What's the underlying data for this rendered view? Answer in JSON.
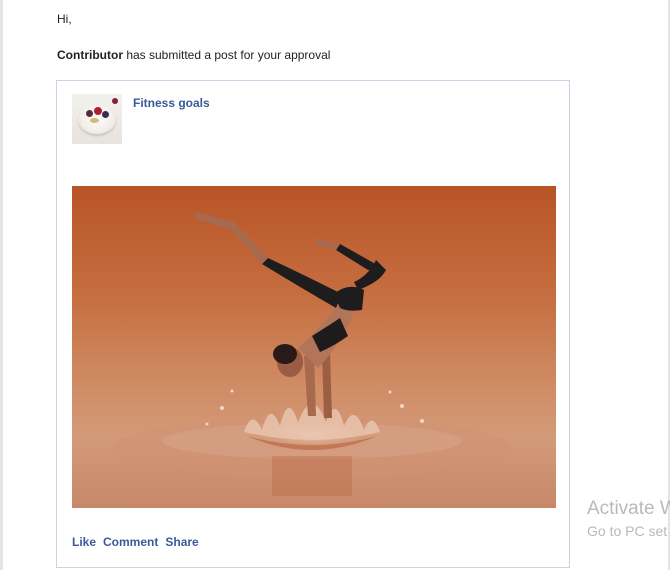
{
  "email": {
    "greeting": "Hi,",
    "contributor_name": "Contributor",
    "message": " has submitted a post for your approval"
  },
  "post": {
    "title": "Fitness goals",
    "thumbnail_icon": "yogurt-bowl-image",
    "main_image": "handstand-splash-photo"
  },
  "actions": {
    "like": "Like",
    "comment": "Comment",
    "share": "Share"
  },
  "watermark": {
    "line1": "Activate W",
    "line2": "Go to PC set"
  },
  "colors": {
    "link": "#3b5998",
    "card_border": "#c9d3e3"
  }
}
